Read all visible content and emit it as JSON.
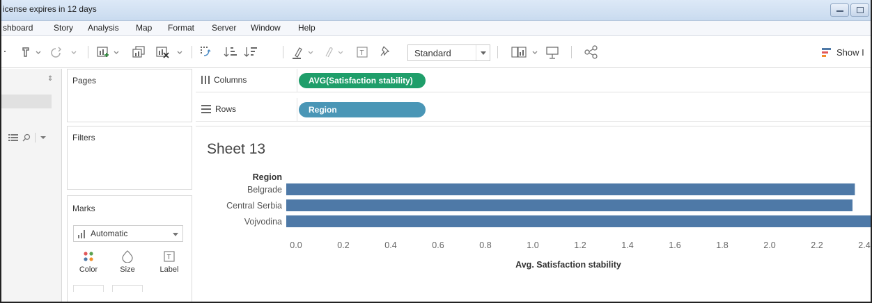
{
  "window": {
    "title": "icense expires in 12 days"
  },
  "menu": {
    "items": [
      "shboard",
      "Story",
      "Analysis",
      "Map",
      "Format",
      "Server",
      "Window",
      "Help"
    ]
  },
  "toolbar": {
    "view_select_value": "Standard",
    "show_me_label": "Show I"
  },
  "panes": {
    "pages_label": "Pages",
    "filters_label": "Filters",
    "marks_label": "Marks",
    "mark_type": "Automatic",
    "mark_buttons": [
      "Color",
      "Size",
      "Label"
    ]
  },
  "shelves": {
    "columns_label": "Columns",
    "columns_pill": "AVG(Satisfaction stability)",
    "rows_label": "Rows",
    "rows_pill": "Region"
  },
  "sheet": {
    "title": "Sheet 13"
  },
  "colors": {
    "bar": "#4e79a7",
    "columns_pill": "#1f9e6a",
    "rows_pill": "#4a96b6"
  },
  "chart_data": {
    "type": "bar",
    "orientation": "horizontal",
    "row_header": "Region",
    "categories": [
      "Belgrade",
      "Central Serbia",
      "Vojvodina"
    ],
    "values": [
      2.36,
      2.35,
      2.45
    ],
    "xlabel": "Avg. Satisfaction stability",
    "xticks": [
      "0.0",
      "0.2",
      "0.4",
      "0.6",
      "0.8",
      "1.0",
      "1.2",
      "1.4",
      "1.6",
      "1.8",
      "2.0",
      "2.2",
      "2.4"
    ],
    "xlim": [
      0,
      2.4
    ],
    "grid": false,
    "legend": "none"
  }
}
